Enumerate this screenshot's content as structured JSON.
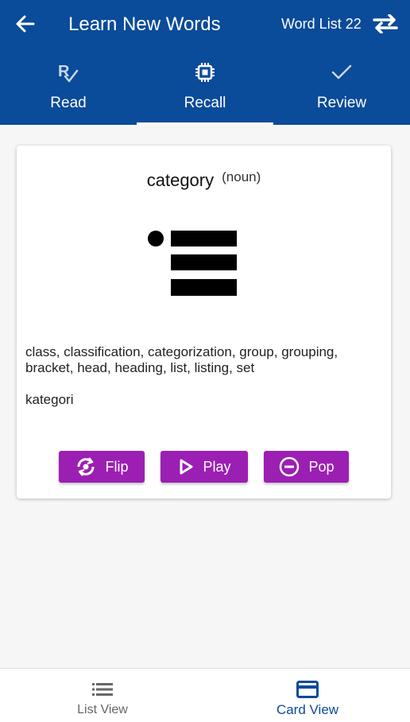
{
  "header": {
    "back_icon": "arrow-left-icon",
    "title": "Learn New Words",
    "list_label": "Word List 22",
    "swap_icon": "swap-arrows-icon",
    "background": "#0a4b9a"
  },
  "tabs": [
    {
      "label": "Read",
      "icon": "rx-check-icon",
      "active": false
    },
    {
      "label": "Recall",
      "icon": "chip-icon",
      "active": true
    },
    {
      "label": "Review",
      "icon": "check-icon",
      "active": false
    }
  ],
  "card": {
    "word": "category",
    "part_of_speech": "(noun)",
    "illustration_icon": "bulleted-list-icon",
    "synonyms": "class, classification, categorization, group, grouping, bracket, head, heading, list, listing, set",
    "translation": "kategori",
    "buttons": {
      "flip": {
        "label": "Flip",
        "icon": "flip-camera-icon"
      },
      "play": {
        "label": "Play",
        "icon": "play-icon"
      },
      "pop": {
        "label": "Pop",
        "icon": "minus-circle-icon"
      }
    },
    "button_color": "#9c1fb3"
  },
  "bottom_nav": [
    {
      "label": "List View",
      "icon": "list-icon",
      "active": false
    },
    {
      "label": "Card View",
      "icon": "card-icon",
      "active": true
    }
  ]
}
